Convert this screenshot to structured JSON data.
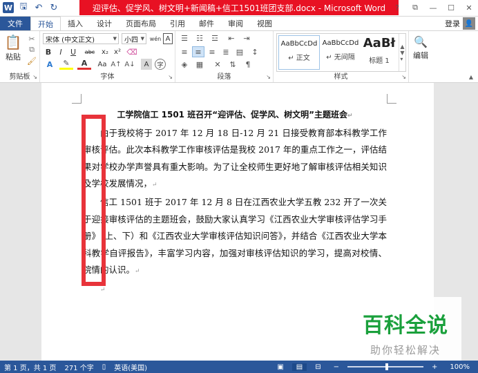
{
  "window": {
    "title": "迎评估、促学风、树文明+新闻稿+信工1501班团支部.docx - Microsoft Word",
    "controls": [
      "?",
      "⧉",
      "—",
      "☐",
      "✕"
    ]
  },
  "qat": {
    "word_icon": "W",
    "save": "🖫",
    "undo": "↶",
    "redo": "↻"
  },
  "tabs": [
    "文件",
    "开始",
    "插入",
    "设计",
    "页面布局",
    "引用",
    "邮件",
    "审阅",
    "视图"
  ],
  "login": {
    "label": "登录",
    "avatar": "👤"
  },
  "ribbon": {
    "clipboard": {
      "paste": "粘贴",
      "label": "剪贴板"
    },
    "font": {
      "font_name": "宋体 (中文正文)",
      "font_size": "小四",
      "wen": "wén",
      "a_box": "A",
      "bold": "B",
      "italic": "I",
      "underline": "U",
      "strike": "abc",
      "sub": "x₂",
      "sup": "x²",
      "label": "字体"
    },
    "paragraph": {
      "label": "段落"
    },
    "styles": {
      "items": [
        {
          "sample": "AaBbCcDd",
          "name": "↵ 正文"
        },
        {
          "sample": "AaBbCcDd",
          "name": "↵ 无间隔"
        },
        {
          "sample": "AaBł",
          "name": "标题 1"
        }
      ],
      "label": "样式"
    },
    "editing": {
      "label": "编辑"
    }
  },
  "document": {
    "title": "工学院信工 1501 班召开“迎评估、促学风、树文明”主题班会",
    "paragraphs": [
      "由于我校将于 2017 年 12 月 18 日-12 月 21 日接受教育部本科教学工作审核评估。此次本科教学工作审核评估是我校 2017 年的重点工作之一，评估结果对学校办学声誉具有重大影响。为了让全校师生更好地了解审核评估相关知识及学校发展情况，",
      "信工 1501 班于 2017 年 12 月 8 日在江西农业大学五教 232 开了一次关于迎接审核评估的主题班会，鼓励大家认真学习《江西农业大学审核评估学习手册》（上、下）和《江西农业大学审核评估知识问答》，并结合《江西农业大学本科教学自评报告》，丰富学习内容，加强对审核评估知识的学习，提高对校情、院情的认识。"
    ]
  },
  "watermark": {
    "main": "百科全说",
    "sub": "助你轻松解决"
  },
  "status": {
    "page": "第 1 页，共 1 页",
    "words": "271 个字",
    "lang": "英语(美国)",
    "zoom": "100%",
    "zoom_fraction": 0.5
  }
}
